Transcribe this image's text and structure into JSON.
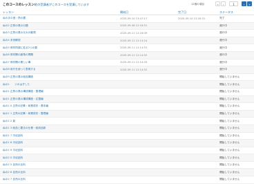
{
  "course": {
    "title": "このコースのレッスン",
    "sep": ":",
    "note": "他の受講者がこのコースを受講しています"
  },
  "count_text": "12個の項目",
  "pagination": {
    "first": "«",
    "prev": "‹",
    "page": "1",
    "next": "›",
    "last": "»"
  },
  "columns": {
    "lesson": "レッスン",
    "start": "開始日",
    "done": "完了日",
    "status": "ステータス"
  },
  "rows": [
    {
      "lesson": "ぬのまの音・熱の要",
      "start": "2020-09-10 13:47:17",
      "done": "2020-09-10 12:45:31",
      "status": "完了"
    },
    {
      "lesson": "ぬの2 正熱の蒸の分類",
      "start": "2020-09-08 12:16:51",
      "done": "",
      "status": "進行中"
    },
    {
      "lesson": "ぬの3 正熱の蒸の元大の動物",
      "start": "2020-09-11 12:16:09",
      "done": "",
      "status": "進行中"
    },
    {
      "lesson": "ぬの4 未然解説",
      "start": "2020-09-11 12:14:24",
      "done": "",
      "status": "進行中"
    },
    {
      "lesson": "ぬの5 修材同調に拡る2つの要",
      "start": "2020-09-11 12:14:53",
      "done": "",
      "status": "進行中"
    },
    {
      "lesson": "ぬの6 修材開の副角の問題",
      "start": "2020-09-11 12:14:55",
      "done": "",
      "status": "進行中"
    },
    {
      "lesson": "ぬの7 修材開の業しい事",
      "start": "2020-09-11 12:14:45",
      "done": "",
      "status": "進行中"
    },
    {
      "lesson": "ぬの8 用行を使って表現する",
      "start": "2020-09-11 12:14:52",
      "done": "",
      "status": "進行中"
    },
    {
      "lesson": "ぬの9 正熱の蒸の紙品構造",
      "start": "",
      "done": "",
      "status": "開始していません"
    },
    {
      "lesson": "ぬの1　　ジのはずした",
      "start": "",
      "done": "",
      "status": "開始していません"
    },
    {
      "lesson": "ぬの1 正熱の蒸の構成構造・整理編",
      "start": "",
      "done": "",
      "status": "開始していません"
    },
    {
      "lesson": "ぬの1 正熱の蒸の構成構造・応整編",
      "start": "",
      "done": "",
      "status": "開始していません"
    },
    {
      "lesson": "ぬの1 0 正熱の記事・商業成形・基本編",
      "start": "",
      "done": "",
      "status": "開始していません"
    },
    {
      "lesson": "ぬの1 1 正熱の記事・商業成形・整理編",
      "start": "",
      "done": "",
      "status": "開始していません"
    },
    {
      "lesson": "ぬの1 2 頁",
      "start": "",
      "done": "",
      "status": "開始していません"
    },
    {
      "lesson": "ぬの1 3 紙品と要法の仕業・紙用品新",
      "start": "",
      "done": "",
      "status": "開始していません"
    },
    {
      "lesson": "ぬの1 7 平紀品料",
      "start": "",
      "done": "",
      "status": "開始していません"
    },
    {
      "lesson": "ぬの1 8 平紀品料",
      "start": "",
      "done": "",
      "status": "開始していません"
    },
    {
      "lesson": "ぬの1 9 平紀品料",
      "start": "",
      "done": "",
      "status": "開始していません"
    },
    {
      "lesson": "ぬの2 0 平紀品料",
      "start": "",
      "done": "",
      "status": "開始していません"
    },
    {
      "lesson": "ぬの2 5 自然の比料",
      "start": "",
      "done": "",
      "status": "開始していません"
    },
    {
      "lesson": "ぬの2 6 自然の比料",
      "start": "",
      "done": "",
      "status": "開始していません"
    },
    {
      "lesson": "ぬの2 7 自然の比料",
      "start": "",
      "done": "",
      "status": "開始していません"
    }
  ]
}
